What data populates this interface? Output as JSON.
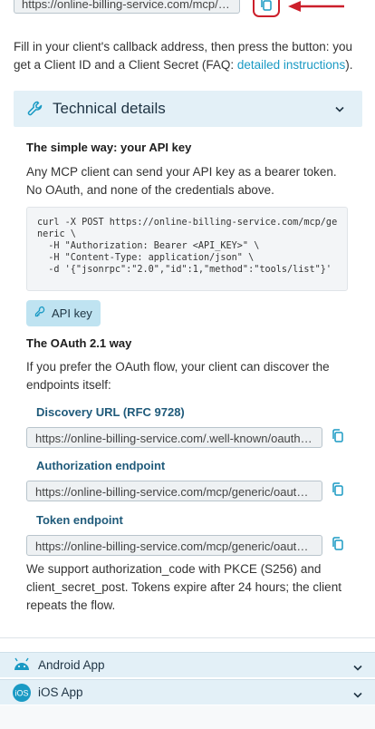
{
  "top": {
    "url_value": "https://online-billing-service.com/mcp/generic"
  },
  "intro": {
    "text_before": "Fill in your client's callback address, then press the button: you get a Client ID and a Client Secret (FAQ: ",
    "link_text": "detailed instructions",
    "text_after": ")."
  },
  "tech": {
    "title": "Technical details"
  },
  "simple": {
    "heading": "The simple way: your API key",
    "body": "Any MCP client can send your API key as a bearer token. No OAuth, and none of the credentials above.",
    "code": "curl -X POST https://online-billing-service.com/mcp/ge\nneric \\\n  -H \"Authorization: Bearer <API_KEY>\" \\\n  -H \"Content-Type: application/json\" \\\n  -d '{\"jsonrpc\":\"2.0\",\"id\":1,\"method\":\"tools/list\"}'",
    "api_key_button": "API key"
  },
  "oauth": {
    "heading": "The OAuth 2.1 way",
    "body": "If you prefer the OAuth flow, your client can discover the endpoints itself:",
    "endpoints": [
      {
        "label": "Discovery URL (RFC 9728)",
        "value": "https://online-billing-service.com/.well-known/oauth-protected-resource"
      },
      {
        "label": "Authorization endpoint",
        "value": "https://online-billing-service.com/mcp/generic/oauth/authorize"
      },
      {
        "label": "Token endpoint",
        "value": "https://online-billing-service.com/mcp/generic/oauth/token"
      }
    ],
    "footer": "We support authorization_code with PKCE (S256) and client_secret_post. Tokens expire after 24 hours; the client repeats the flow."
  },
  "apps": {
    "android": "Android App",
    "ios": "iOS App",
    "ios_badge": "iOS"
  },
  "colors": {
    "accent": "#1a9ac4",
    "highlight_red": "#cc1f2b",
    "header_bg": "#e3f0f7"
  }
}
